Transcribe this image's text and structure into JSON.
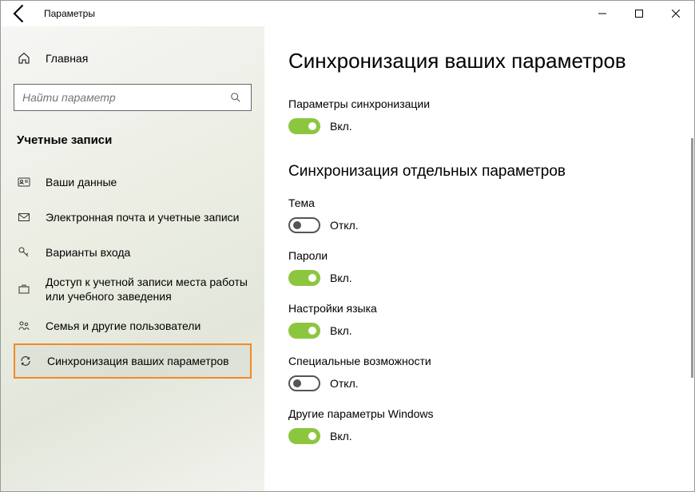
{
  "window": {
    "title": "Параметры"
  },
  "sidebar": {
    "home": "Главная",
    "search_placeholder": "Найти параметр",
    "section": "Учетные записи",
    "items": [
      {
        "label": "Ваши данные"
      },
      {
        "label": "Электронная почта и учетные записи"
      },
      {
        "label": "Варианты входа"
      },
      {
        "label": "Доступ к учетной записи места работы или учебного заведения"
      },
      {
        "label": "Семья и другие пользователи"
      },
      {
        "label": "Синхронизация ваших параметров"
      }
    ]
  },
  "page": {
    "title": "Синхронизация ваших параметров",
    "sync_settings_label": "Параметры синхронизации",
    "individual_heading": "Синхронизация отдельных параметров",
    "on_text": "Вкл.",
    "off_text": "Откл.",
    "toggles": {
      "master": true,
      "theme_label": "Тема",
      "theme": false,
      "passwords_label": "Пароли",
      "passwords": true,
      "language_label": "Настройки языка",
      "language": true,
      "ease_label": "Специальные возможности",
      "ease": false,
      "other_label": "Другие параметры Windows",
      "other": true
    }
  }
}
